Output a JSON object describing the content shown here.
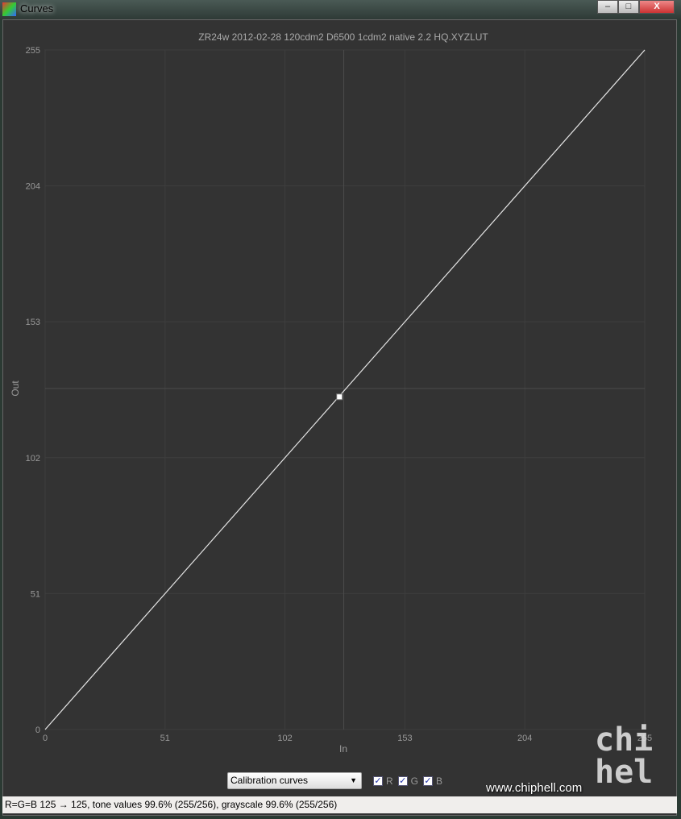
{
  "window": {
    "title": "Curves",
    "minimize": "–",
    "maximize": "□",
    "close": "X"
  },
  "chart_data": {
    "type": "line",
    "title": "ZR24w 2012-02-28 120cdm2 D6500 1cdm2 native 2.2 HQ.XYZLUT",
    "xlabel": "In",
    "ylabel": "Out",
    "xlim": [
      0,
      255
    ],
    "ylim": [
      0,
      255
    ],
    "xticks": [
      "0",
      "51",
      "102",
      "153",
      "204",
      "255"
    ],
    "yticks": [
      "0",
      "51",
      "102",
      "153",
      "204",
      "255"
    ],
    "grid": true,
    "series": [
      {
        "x": [
          0,
          255
        ],
        "y": [
          0,
          255
        ],
        "color": "#e6e6e6"
      }
    ],
    "marker": {
      "x": 125,
      "y": 125
    },
    "cursor": {
      "x": 127,
      "y": 128
    }
  },
  "controls": {
    "mode": "Calibration curves",
    "channels": [
      {
        "label": "R",
        "checked": true
      },
      {
        "label": "G",
        "checked": true
      },
      {
        "label": "B",
        "checked": true
      }
    ]
  },
  "status": "R=G=B 125 → 125, tone values 99.6% (255/256), grayscale 99.6% (255/256)",
  "watermark": {
    "url": "www.chiphell.com",
    "logo": "chip hell"
  }
}
